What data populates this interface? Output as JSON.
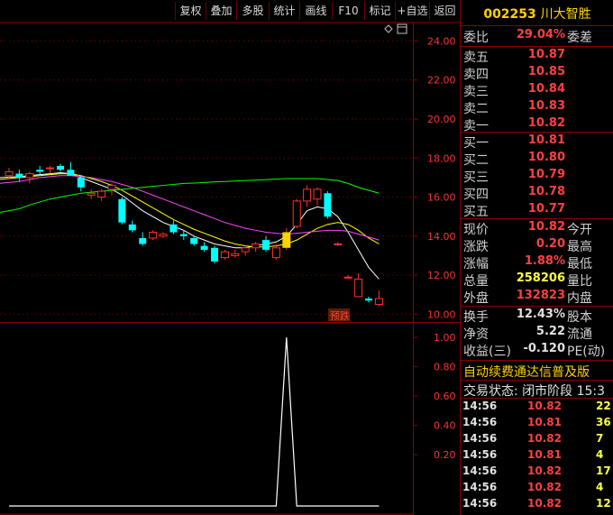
{
  "toolbar": {
    "buttons": [
      "复权",
      "叠加",
      "多股",
      "统计",
      "画线",
      "F10",
      "标记",
      "+自选",
      "返回"
    ]
  },
  "icons": {
    "diamond": "diamond-icon",
    "window": "window-icon"
  },
  "colors": {
    "up": "#ff3030",
    "down": "#00ffff",
    "ma1": "#ffffff",
    "ma2": "#ffff00",
    "ma3": "#ff44ff",
    "ma4": "#00ff00",
    "axis_red": "#8b0000",
    "brand_yellow": "#ffd200"
  },
  "chart_data": [
    {
      "type": "candlestick",
      "y_tick_labels": [
        "24.00",
        "22.00",
        "20.00",
        "18.00",
        "16.00",
        "14.00",
        "12.00",
        "10.00"
      ],
      "ylim": [
        9.6,
        24.9
      ],
      "annotation": "预跌",
      "candles": [
        {
          "o": 17.1,
          "h": 17.5,
          "l": 16.9,
          "c": 17.3
        },
        {
          "o": 17.2,
          "h": 17.4,
          "l": 16.8,
          "c": 17.0
        },
        {
          "o": 17.0,
          "h": 17.3,
          "l": 16.7,
          "c": 17.2
        },
        {
          "o": 17.4,
          "h": 17.6,
          "l": 17.1,
          "c": 17.3
        },
        {
          "o": 17.5,
          "h": 17.6,
          "l": 17.2,
          "c": 17.5
        },
        {
          "o": 17.6,
          "h": 17.7,
          "l": 17.3,
          "c": 17.4
        },
        {
          "o": 17.4,
          "h": 17.8,
          "l": 17.2,
          "c": 17.1
        },
        {
          "o": 17.0,
          "h": 17.1,
          "l": 16.3,
          "c": 16.5
        },
        {
          "o": 16.1,
          "h": 16.4,
          "l": 15.9,
          "c": 16.2
        },
        {
          "o": 16.0,
          "h": 16.4,
          "l": 15.8,
          "c": 16.3
        },
        {
          "o": 16.4,
          "h": 16.7,
          "l": 16.1,
          "c": 16.6
        },
        {
          "o": 15.9,
          "h": 16.0,
          "l": 14.6,
          "c": 14.7
        },
        {
          "o": 14.6,
          "h": 14.8,
          "l": 14.2,
          "c": 14.3
        },
        {
          "o": 13.9,
          "h": 14.2,
          "l": 13.5,
          "c": 13.6
        },
        {
          "o": 13.9,
          "h": 14.3,
          "l": 13.8,
          "c": 14.2
        },
        {
          "o": 14.0,
          "h": 14.2,
          "l": 13.9,
          "c": 14.1
        },
        {
          "o": 14.6,
          "h": 14.8,
          "l": 14.1,
          "c": 14.2
        },
        {
          "o": 14.1,
          "h": 14.3,
          "l": 13.8,
          "c": 14.0
        },
        {
          "o": 13.9,
          "h": 14.0,
          "l": 13.5,
          "c": 13.6
        },
        {
          "o": 13.5,
          "h": 13.7,
          "l": 13.2,
          "c": 13.3
        },
        {
          "o": 13.4,
          "h": 13.5,
          "l": 12.6,
          "c": 12.7
        },
        {
          "o": 12.9,
          "h": 13.3,
          "l": 12.8,
          "c": 13.2
        },
        {
          "o": 13.0,
          "h": 13.3,
          "l": 12.9,
          "c": 13.1
        },
        {
          "o": 13.2,
          "h": 13.5,
          "l": 13.0,
          "c": 13.4
        },
        {
          "o": 13.4,
          "h": 13.7,
          "l": 13.2,
          "c": 13.6
        },
        {
          "o": 13.8,
          "h": 14.0,
          "l": 13.2,
          "c": 13.3
        },
        {
          "o": 12.9,
          "h": 13.6,
          "l": 12.8,
          "c": 13.4
        },
        {
          "o": 13.4,
          "h": 14.4,
          "l": 13.3,
          "c": 14.2
        },
        {
          "o": 14.5,
          "h": 15.9,
          "l": 14.4,
          "c": 15.8
        },
        {
          "o": 15.8,
          "h": 16.6,
          "l": 15.5,
          "c": 16.4
        },
        {
          "o": 15.9,
          "h": 16.5,
          "l": 15.6,
          "c": 16.4
        },
        {
          "o": 16.2,
          "h": 16.3,
          "l": 14.9,
          "c": 15.0
        },
        {
          "o": 13.6,
          "h": 13.7,
          "l": 13.5,
          "c": 13.6
        },
        {
          "o": 11.9,
          "h": 12.0,
          "l": 11.8,
          "c": 11.9
        },
        {
          "o": 10.9,
          "h": 12.1,
          "l": 10.9,
          "c": 11.8
        },
        {
          "o": 10.8,
          "h": 10.9,
          "l": 10.6,
          "c": 10.7
        },
        {
          "o": 10.5,
          "h": 11.2,
          "l": 10.4,
          "c": 10.8
        }
      ],
      "ma_lines": [
        {
          "values": [
            17.0,
            17.05,
            17.1,
            17.15,
            17.2,
            17.25,
            17.2,
            17.0,
            16.8,
            16.6,
            16.4,
            16.1,
            15.7,
            15.3,
            15.0,
            14.7,
            14.5,
            14.3,
            14.0,
            13.8,
            13.6,
            13.5,
            13.4,
            13.4,
            13.5,
            13.6,
            13.7,
            14.0,
            14.6,
            15.3,
            15.5,
            15.4,
            15.0,
            14.2,
            13.3,
            12.4,
            11.8
          ]
        },
        {
          "values": [
            16.9,
            17.0,
            17.05,
            17.1,
            17.15,
            17.2,
            17.2,
            17.1,
            16.95,
            16.8,
            16.6,
            16.35,
            16.05,
            15.75,
            15.45,
            15.15,
            14.85,
            14.6,
            14.35,
            14.15,
            13.95,
            13.75,
            13.6,
            13.5,
            13.45,
            13.45,
            13.5,
            13.6,
            13.8,
            14.1,
            14.4,
            14.6,
            14.7,
            14.6,
            14.3,
            13.9,
            13.6
          ]
        },
        {
          "values": [
            16.7,
            16.8,
            16.9,
            17.0,
            17.05,
            17.1,
            17.1,
            17.05,
            17.0,
            16.9,
            16.8,
            16.65,
            16.5,
            16.3,
            16.1,
            15.9,
            15.7,
            15.5,
            15.3,
            15.1,
            14.9,
            14.7,
            14.55,
            14.4,
            14.3,
            14.2,
            14.15,
            14.1,
            14.15,
            14.2,
            14.25,
            14.3,
            14.3,
            14.25,
            14.1,
            13.95,
            13.8
          ]
        },
        {
          "values": [
            15.2,
            15.4,
            15.6,
            15.75,
            15.9,
            16.0,
            16.1,
            16.2,
            16.25,
            16.3,
            16.35,
            16.4,
            16.45,
            16.5,
            16.55,
            16.6,
            16.65,
            16.7,
            16.72,
            16.75,
            16.78,
            16.8,
            16.82,
            16.85,
            16.87,
            16.9,
            16.92,
            16.95,
            16.95,
            16.95,
            16.95,
            16.9,
            16.85,
            16.7,
            16.5,
            16.35,
            16.2
          ]
        }
      ]
    },
    {
      "type": "line",
      "y_tick_labels": [
        "1.00",
        "0.80",
        "0.60",
        "0.40",
        "0.20"
      ],
      "ylim": [
        -0.2,
        1.05
      ],
      "values": [
        0,
        0,
        0,
        0,
        0,
        0,
        0,
        0,
        0,
        0,
        0,
        0,
        0,
        0,
        0,
        0,
        0,
        0,
        0,
        0,
        0,
        0,
        0,
        0,
        0,
        0,
        0,
        1,
        0,
        0,
        0,
        0,
        0,
        0,
        0,
        0,
        0
      ]
    }
  ],
  "panel": {
    "code": "002253",
    "name": "川大智胜",
    "weibi": {
      "label": "委比",
      "value": "29.04%",
      "label2": "委差"
    },
    "sell": [
      {
        "label": "卖五",
        "price": "10.87"
      },
      {
        "label": "卖四",
        "price": "10.85"
      },
      {
        "label": "卖三",
        "price": "10.84"
      },
      {
        "label": "卖二",
        "price": "10.83"
      },
      {
        "label": "卖一",
        "price": "10.82"
      }
    ],
    "buy": [
      {
        "label": "买一",
        "price": "10.81"
      },
      {
        "label": "买二",
        "price": "10.80"
      },
      {
        "label": "买三",
        "price": "10.79"
      },
      {
        "label": "买四",
        "price": "10.78"
      },
      {
        "label": "买五",
        "price": "10.77"
      }
    ],
    "stats": [
      {
        "label": "现价",
        "value": "10.82",
        "label2": "今开",
        "color": "#ff4040"
      },
      {
        "label": "涨跌",
        "value": "0.20",
        "label2": "最高",
        "color": "#ff4040"
      },
      {
        "label": "涨幅",
        "value": "1.88%",
        "label2": "最低",
        "color": "#ff4040"
      },
      {
        "label": "总量",
        "value": "258206",
        "label2": "量比",
        "color": "#ffff40"
      },
      {
        "label": "外盘",
        "value": "132823",
        "label2": "内盘",
        "color": "#ff4040"
      }
    ],
    "fin": [
      {
        "label": "换手",
        "value": "12.43%",
        "label2": "股本"
      },
      {
        "label": "净资",
        "value": "5.22",
        "label2": "流通"
      },
      {
        "label": "收益(三)",
        "value": "-0.120",
        "label2": "PE(动)"
      }
    ],
    "ad": "自动续费通达信普及版",
    "status": "交易状态: 闭市阶段 15:3",
    "ticks": [
      {
        "time": "14:56",
        "price": "10.82",
        "vol": "22",
        "pcolor": "#ff4040",
        "vcolor": "#ffff40"
      },
      {
        "time": "14:56",
        "price": "10.81",
        "vol": "36",
        "pcolor": "#ff4040",
        "vcolor": "#ffff40"
      },
      {
        "time": "14:56",
        "price": "10.82",
        "vol": "7",
        "pcolor": "#ff4040",
        "vcolor": "#ffff40"
      },
      {
        "time": "14:56",
        "price": "10.81",
        "vol": "4",
        "pcolor": "#ff4040",
        "vcolor": "#ffff40"
      },
      {
        "time": "14:56",
        "price": "10.82",
        "vol": "17",
        "pcolor": "#ff4040",
        "vcolor": "#ffff40"
      },
      {
        "time": "14:56",
        "price": "10.82",
        "vol": "4",
        "pcolor": "#ff4040",
        "vcolor": "#ffff40"
      },
      {
        "time": "14:56",
        "price": "10.82",
        "vol": "12",
        "pcolor": "#ff4040",
        "vcolor": "#ffff40"
      }
    ]
  }
}
